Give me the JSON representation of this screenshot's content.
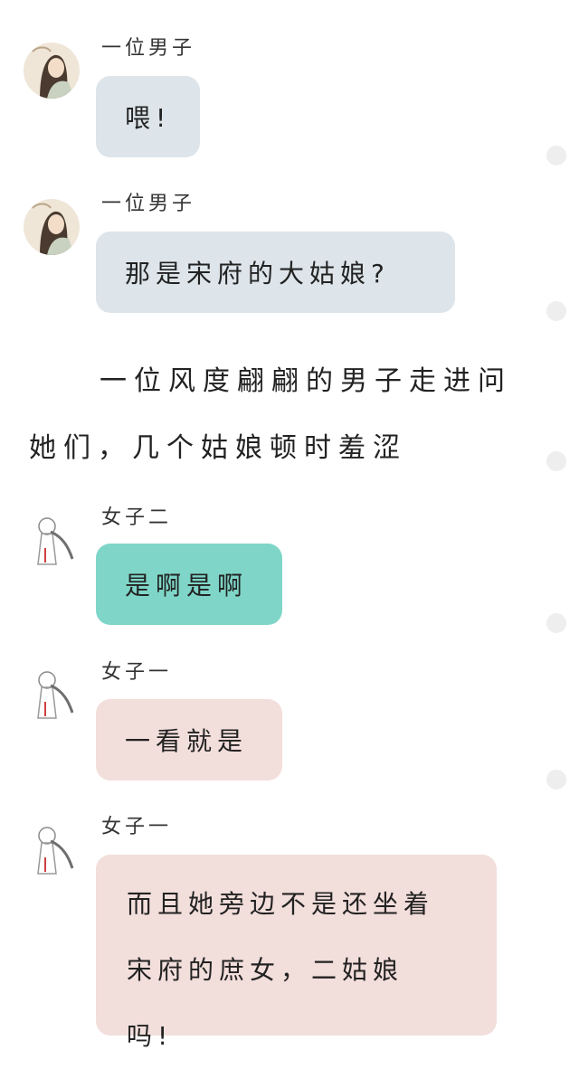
{
  "messages": [
    {
      "speaker": "一位男子",
      "text": "喂!"
    },
    {
      "speaker": "一位男子",
      "text": "那是宋府的大姑娘?"
    },
    {
      "speaker": "女子二",
      "text": "是啊是啊"
    },
    {
      "speaker": "女子一",
      "text": "一看就是"
    },
    {
      "speaker": "女子一",
      "text_lines": [
        "而且她旁边不是还坐着",
        "宋府的庶女，二姑娘",
        "吗!"
      ]
    }
  ],
  "narration": {
    "line1": "一位风度翩翩的男子走进问",
    "line2": "她们，几个姑娘顿时羞涩"
  },
  "colors": {
    "bubble_male": "#dde5ea",
    "bubble_female_two": "#7fd6c8",
    "bubble_female_one": "#f2dedb",
    "side_dot": "#eeeeee"
  },
  "icons": {
    "male_avatar": "male-character-avatar",
    "female_avatar": "female-character-avatar",
    "side_dot": "scroll-dot"
  }
}
